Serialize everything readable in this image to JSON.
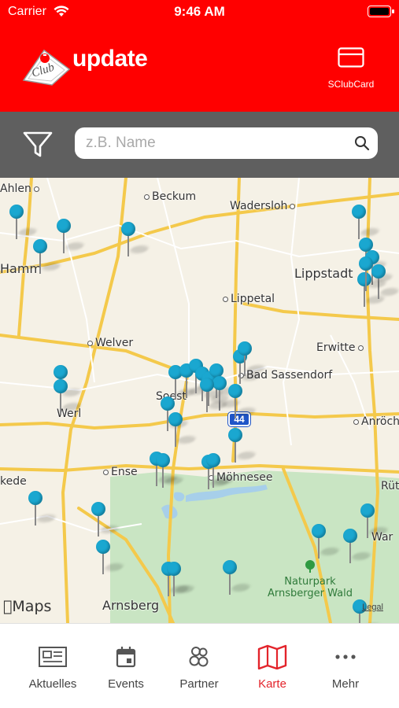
{
  "status_bar": {
    "carrier": "Carrier",
    "time": "9:46 AM"
  },
  "header": {
    "app_title": "update",
    "card_button_label": "SClubCard",
    "logo_name": "s-club-logo"
  },
  "search": {
    "placeholder": "z.B. Name",
    "value": ""
  },
  "map": {
    "places": {
      "ahlen": "Ahlen",
      "beckum": "Beckum",
      "wadersloh": "Wadersloh",
      "hamm": "Hamm",
      "lippstadt": "Lippstadt",
      "lippetal": "Lippetal",
      "welver": "Welver",
      "erwitte": "Erwitte",
      "bad_sassendorf": "Bad Sassendorf",
      "soest": "Soest",
      "werl": "Werl",
      "anroechte": "Anröch",
      "ense": "Ense",
      "moehnesee": "Möhnesee",
      "ruethen": "Rüt",
      "wickede": "kede",
      "warstein": "War",
      "arnsberg": "Arnsberg"
    },
    "park_line1": "Naturpark",
    "park_line2": "Arnsberger Wald",
    "highway_badge": "44",
    "maps_brand": "Maps",
    "legal": "Legal",
    "pin_color": "#1aa7d0",
    "park_color": "#c9e5c3"
  },
  "tabs": [
    {
      "label": "Aktuelles",
      "icon": "newspaper-icon",
      "active": false
    },
    {
      "label": "Events",
      "icon": "calendar-icon",
      "active": false
    },
    {
      "label": "Partner",
      "icon": "partner-icon",
      "active": false
    },
    {
      "label": "Karte",
      "icon": "map-icon",
      "active": true
    },
    {
      "label": "Mehr",
      "icon": "more-icon",
      "active": false
    }
  ],
  "colors": {
    "brand_red": "#ff0000",
    "active_tab": "#e3242b",
    "search_bar_bg": "#5f5f5f"
  }
}
